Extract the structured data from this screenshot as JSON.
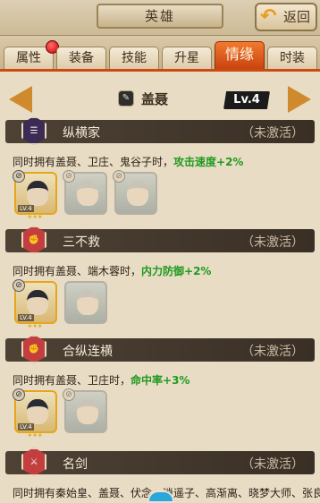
{
  "header": {
    "title": "英雄",
    "back_label": "返回"
  },
  "tabs": [
    {
      "label": "属性",
      "active": false,
      "has_dot": true
    },
    {
      "label": "装备",
      "active": false
    },
    {
      "label": "技能",
      "active": false
    },
    {
      "label": "升星",
      "active": false
    },
    {
      "label": "情缘",
      "active": true
    },
    {
      "label": "时装",
      "active": false
    }
  ],
  "hero": {
    "name": "盖聂",
    "level": "Lv.4"
  },
  "bonds": [
    {
      "name": "纵横家",
      "status": "（未激活）",
      "desc_prefix": "同时拥有盖聂、卫庄、鬼谷子时，",
      "bonus": "攻击速度+2%",
      "portraits": [
        {
          "state": "owned",
          "level": "LV.4"
        },
        {
          "state": "locked"
        },
        {
          "state": "locked"
        }
      ]
    },
    {
      "name": "三不救",
      "status": "（未激活）",
      "desc_prefix": "同时拥有盖聂、端木蓉时，",
      "bonus": "内力防御+2%",
      "portraits": [
        {
          "state": "owned",
          "level": "LV.4"
        },
        {
          "state": "locked"
        }
      ]
    },
    {
      "name": "合纵连横",
      "status": "（未激活）",
      "desc_prefix": "同时拥有盖聂、卫庄时，",
      "bonus": "命中率+3%",
      "portraits": [
        {
          "state": "owned",
          "level": "LV.4"
        },
        {
          "state": "locked"
        }
      ]
    },
    {
      "name": "名剑",
      "status": "（未激活）",
      "desc_prefix": "同时拥有秦始皇、盖聂、伏念、逍遥子、高渐离、晓梦大师、张良",
      "bonus": ""
    }
  ],
  "colors": {
    "accent": "#c94b12",
    "bonus": "#1f9a1f",
    "header_bg": "#4e4235"
  }
}
